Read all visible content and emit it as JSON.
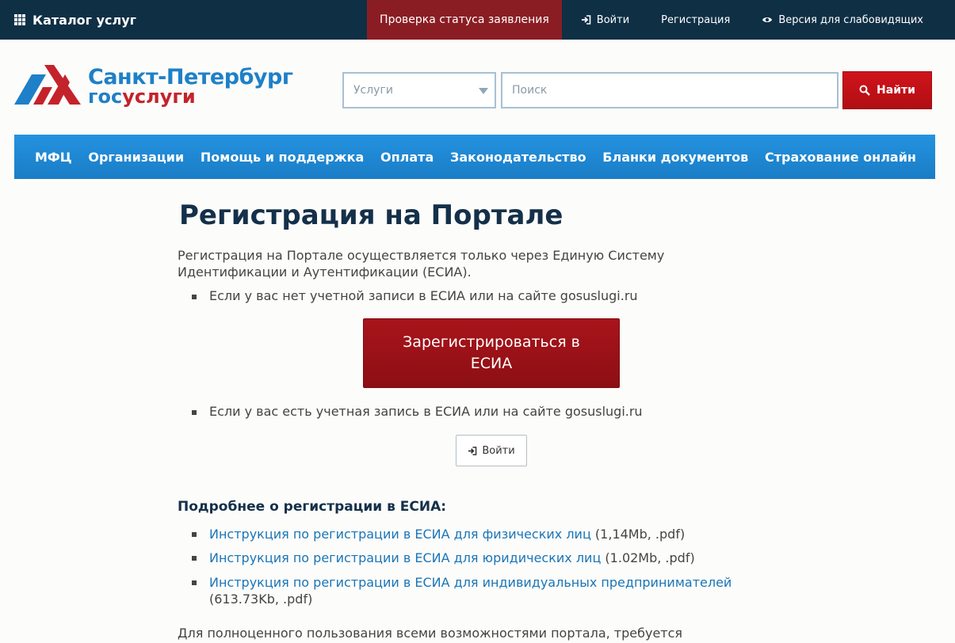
{
  "topbar": {
    "catalog_label": "Каталог услуг",
    "status_label": "Проверка статуса заявления",
    "login_label": "Войти",
    "register_label": "Регистрация",
    "accessibility_label": "Версия для слабовидящих"
  },
  "logo": {
    "line1": "Санкт-Петербург",
    "line2_part1": "гос",
    "line2_part2": "услуги"
  },
  "search": {
    "category_value": "Услуги",
    "placeholder": "Поиск",
    "button_label": "Найти"
  },
  "nav": {
    "items": [
      {
        "label": "МФЦ"
      },
      {
        "label": "Организации"
      },
      {
        "label": "Помощь и поддержка"
      },
      {
        "label": "Оплата"
      },
      {
        "label": "Законодательство"
      },
      {
        "label": "Бланки документов"
      },
      {
        "label": "Страхование онлайн"
      }
    ]
  },
  "content": {
    "title": "Регистрация на Портале",
    "intro": "Регистрация на Портале осуществляется только через Единую Систему Идентификации и Аутентификации (ЕСИА).",
    "bullet_no_account": "Если у вас нет учетной записи в ЕСИА или на сайте gosuslugi.ru",
    "register_button": "Зарегистрироваться в ЕСИА",
    "bullet_has_account": "Если у вас есть учетная запись в ЕСИА или на сайте gosuslugi.ru",
    "login_button": "Войти",
    "more_heading": "Подробнее о регистрации в ЕСИА:",
    "docs": [
      {
        "link": "Инструкция по регистрации в ЕСИА для физических лиц",
        "meta": " (1,14Mb, .pdf)"
      },
      {
        "link": "Инструкция по регистрации в ЕСИА для юридических лиц",
        "meta": " (1.02Mb, .pdf)"
      },
      {
        "link": "Инструкция по регистрации в ЕСИА для индивидуальных предпринимателей",
        "meta": " (613.73Kb, .pdf)"
      }
    ],
    "footer_text": "Для полноценного пользования всеми возможностями портала, требуется"
  },
  "colors": {
    "topbar_bg": "#0f2f45",
    "status_bg": "#8a1d23",
    "nav_bg": "#1a7dc6",
    "brand_blue": "#1e80c8",
    "brand_red": "#c4232b",
    "register_button_bg": "#9d1218",
    "link": "#1a75b8"
  },
  "icons": {
    "catalog": "grid-icon",
    "login": "sign-in-icon",
    "accessibility": "eye-icon",
    "search": "search-icon",
    "select": "caret-down-icon"
  }
}
